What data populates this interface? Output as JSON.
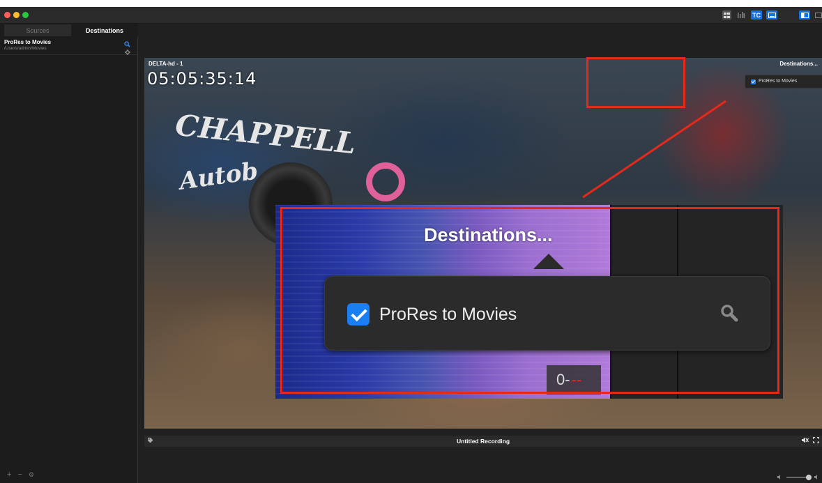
{
  "window": {
    "traffic_lights": {
      "close": "#ff5f57",
      "minimize": "#febc2e",
      "zoom": "#28c840"
    },
    "toolbar": {
      "grid_icon": "grid-view-icon",
      "meter_icon": "audio-meter-icon",
      "tc_label": "TC",
      "preview_icon": "preview-icon",
      "sidebar_icon": "sidebar-toggle-icon"
    }
  },
  "sidebar": {
    "tabs": [
      {
        "label": "Sources",
        "active": false
      },
      {
        "label": "Destinations",
        "active": true
      }
    ],
    "destination": {
      "name": "ProRes to Movies",
      "path": "/Users/admin/Movies"
    },
    "footer": {
      "add": "+",
      "remove": "−",
      "settings": "⚙"
    }
  },
  "video": {
    "camera_label": "DELTA-hd - 1",
    "timecode": "05:05:35:14",
    "graffiti_1": "CHAPPELL",
    "graffiti_2": "Autob",
    "destinations_title": "Destinations...",
    "destination_option": "ProRes to Movies",
    "footer_title": "Untitled Recording"
  },
  "zoom_callout": {
    "title": "Destinations...",
    "option_label": "ProRes to Movies",
    "counter": "0-",
    "counter_red": "--"
  },
  "colors": {
    "highlight": "#e52a1a",
    "accent": "#1a7ff3",
    "tc_badge": "#1a6fe0"
  }
}
